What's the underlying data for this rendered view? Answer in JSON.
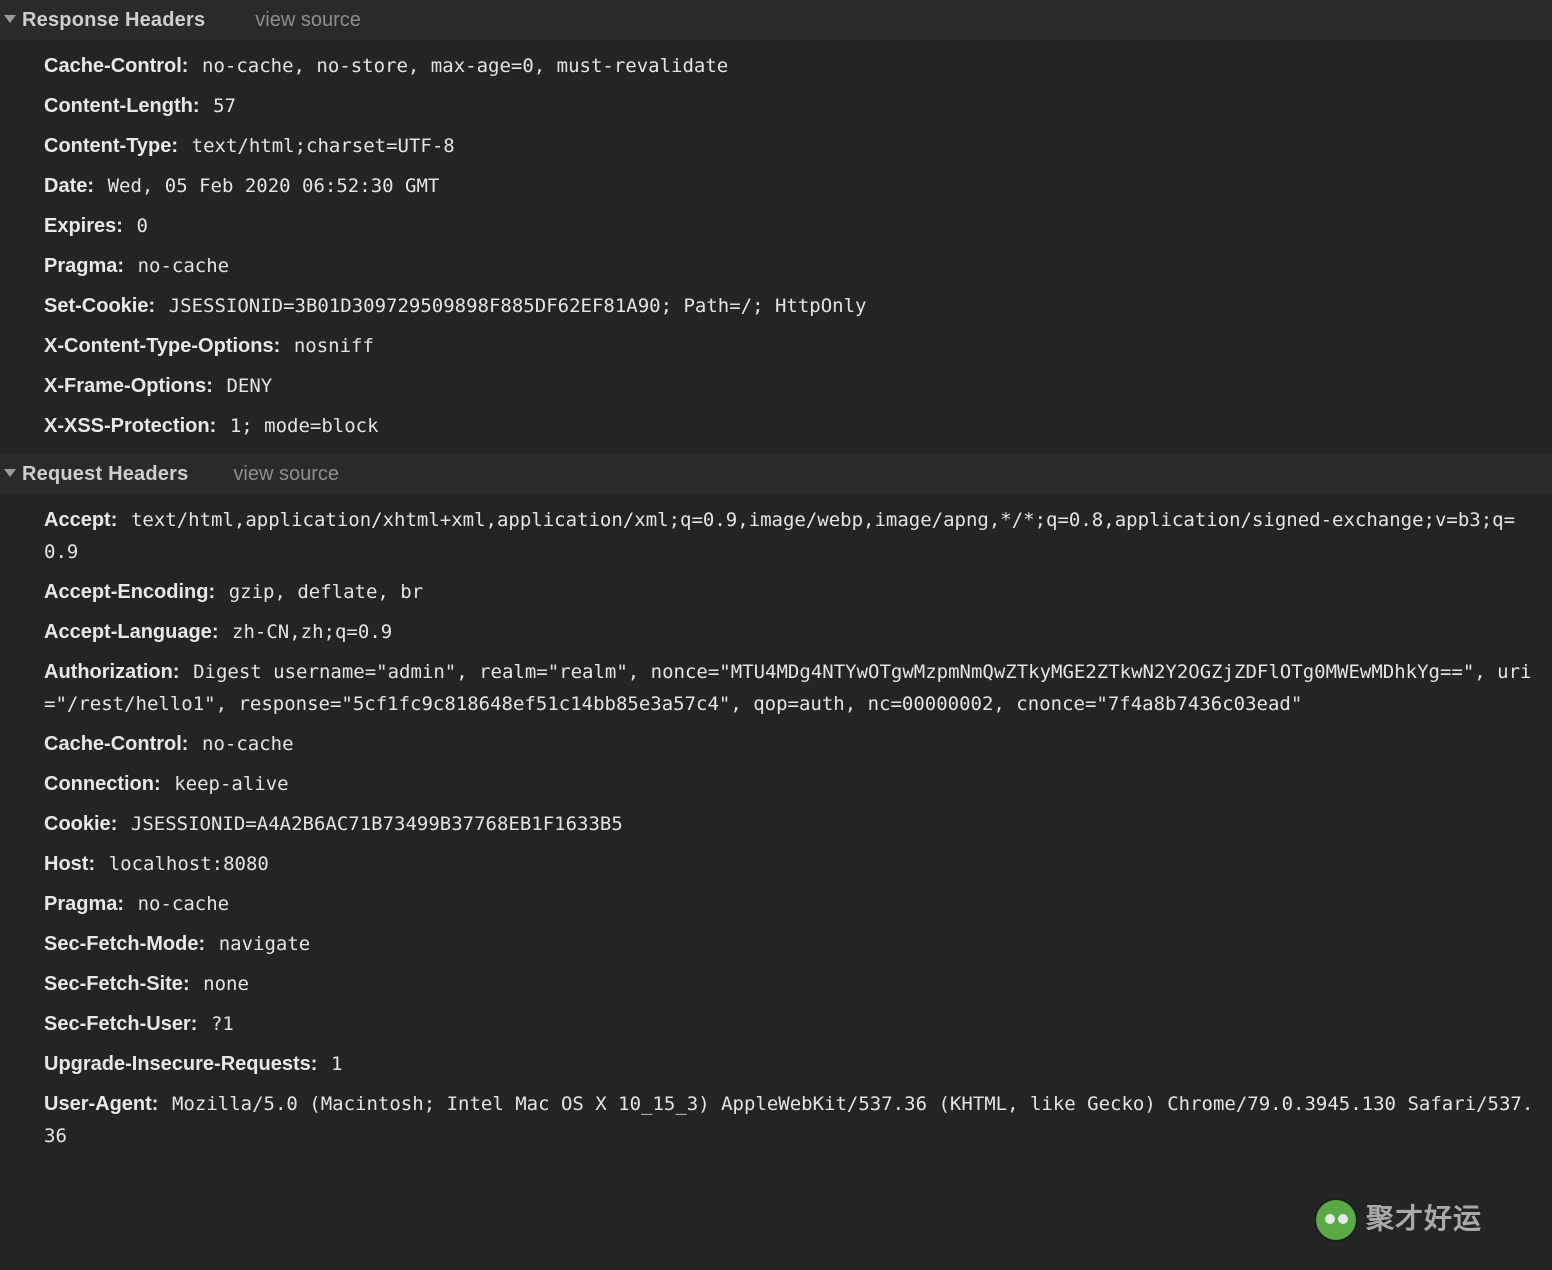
{
  "sections": {
    "response": {
      "title": "Response Headers",
      "view_source": "view source",
      "headers": [
        {
          "name": "Cache-Control",
          "value": "no-cache, no-store, max-age=0, must-revalidate"
        },
        {
          "name": "Content-Length",
          "value": "57"
        },
        {
          "name": "Content-Type",
          "value": "text/html;charset=UTF-8"
        },
        {
          "name": "Date",
          "value": "Wed, 05 Feb 2020 06:52:30 GMT"
        },
        {
          "name": "Expires",
          "value": "0"
        },
        {
          "name": "Pragma",
          "value": "no-cache"
        },
        {
          "name": "Set-Cookie",
          "value": "JSESSIONID=3B01D309729509898F885DF62EF81A90; Path=/; HttpOnly"
        },
        {
          "name": "X-Content-Type-Options",
          "value": "nosniff"
        },
        {
          "name": "X-Frame-Options",
          "value": "DENY"
        },
        {
          "name": "X-XSS-Protection",
          "value": "1; mode=block"
        }
      ]
    },
    "request": {
      "title": "Request Headers",
      "view_source": "view source",
      "headers": [
        {
          "name": "Accept",
          "value": "text/html,application/xhtml+xml,application/xml;q=0.9,image/webp,image/apng,*/*;q=0.8,application/signed-exchange;v=b3;q=0.9"
        },
        {
          "name": "Accept-Encoding",
          "value": "gzip, deflate, br"
        },
        {
          "name": "Accept-Language",
          "value": "zh-CN,zh;q=0.9"
        },
        {
          "name": "Authorization",
          "value": "Digest username=\"admin\", realm=\"realm\", nonce=\"MTU4MDg4NTYwOTgwMzpmNmQwZTkyMGE2ZTkwN2Y2OGZjZDFlOTg0MWEwMDhkYg==\", uri=\"/rest/hello1\", response=\"5cf1fc9c818648ef51c14bb85e3a57c4\", qop=auth, nc=00000002, cnonce=\"7f4a8b7436c03ead\""
        },
        {
          "name": "Cache-Control",
          "value": "no-cache"
        },
        {
          "name": "Connection",
          "value": "keep-alive"
        },
        {
          "name": "Cookie",
          "value": "JSESSIONID=A4A2B6AC71B73499B37768EB1F1633B5"
        },
        {
          "name": "Host",
          "value": "localhost:8080"
        },
        {
          "name": "Pragma",
          "value": "no-cache"
        },
        {
          "name": "Sec-Fetch-Mode",
          "value": "navigate"
        },
        {
          "name": "Sec-Fetch-Site",
          "value": "none"
        },
        {
          "name": "Sec-Fetch-User",
          "value": "?1"
        },
        {
          "name": "Upgrade-Insecure-Requests",
          "value": "1"
        },
        {
          "name": "User-Agent",
          "value": "Mozilla/5.0 (Macintosh; Intel Mac OS X 10_15_3) AppleWebKit/537.36 (KHTML, like Gecko) Chrome/79.0.3945.130 Safari/537.36"
        }
      ]
    }
  },
  "watermark": {
    "text": "聚才好运",
    "icon": "wechat-icon",
    "icon_color": "#60b84a"
  }
}
